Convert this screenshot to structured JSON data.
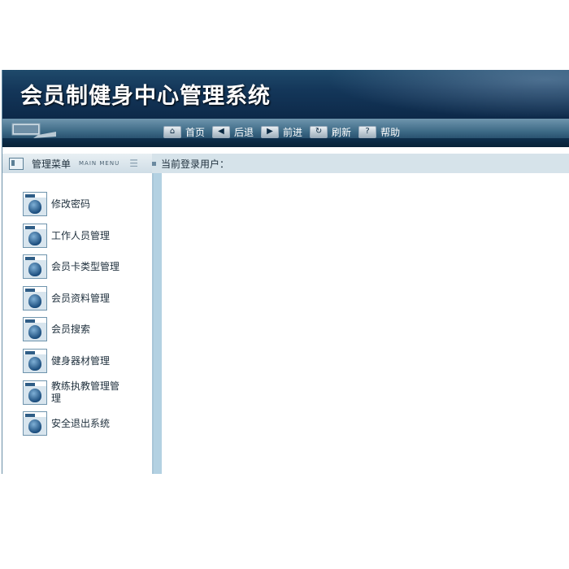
{
  "header": {
    "title": "会员制健身中心管理系统"
  },
  "toolbar": {
    "buttons": [
      {
        "label": "首页",
        "icon": "home-icon",
        "glyph": "⌂"
      },
      {
        "label": "后退",
        "icon": "back-arrow-icon",
        "glyph": "◀"
      },
      {
        "label": "前进",
        "icon": "forward-arrow-icon",
        "glyph": "▶"
      },
      {
        "label": "刷新",
        "icon": "refresh-icon",
        "glyph": "↻"
      },
      {
        "label": "帮助",
        "icon": "help-icon",
        "glyph": "?"
      }
    ]
  },
  "menu_panel": {
    "title": "管理菜单",
    "title_en": "MAIN MENU"
  },
  "user": {
    "label": "当前登录用户："
  },
  "sidebar": {
    "items": [
      {
        "label": "修改密码"
      },
      {
        "label": "工作人员管理"
      },
      {
        "label": "会员卡类型管理"
      },
      {
        "label": "会员资料管理"
      },
      {
        "label": "会员搜索"
      },
      {
        "label": "健身器材管理"
      },
      {
        "label": "教练执教管理管理"
      },
      {
        "label": "安全退出系统"
      }
    ]
  },
  "colors": {
    "header_dark": "#0d2949",
    "sidebar_border": "#a9c6d8",
    "panel_bar": "#d6e3ea"
  }
}
